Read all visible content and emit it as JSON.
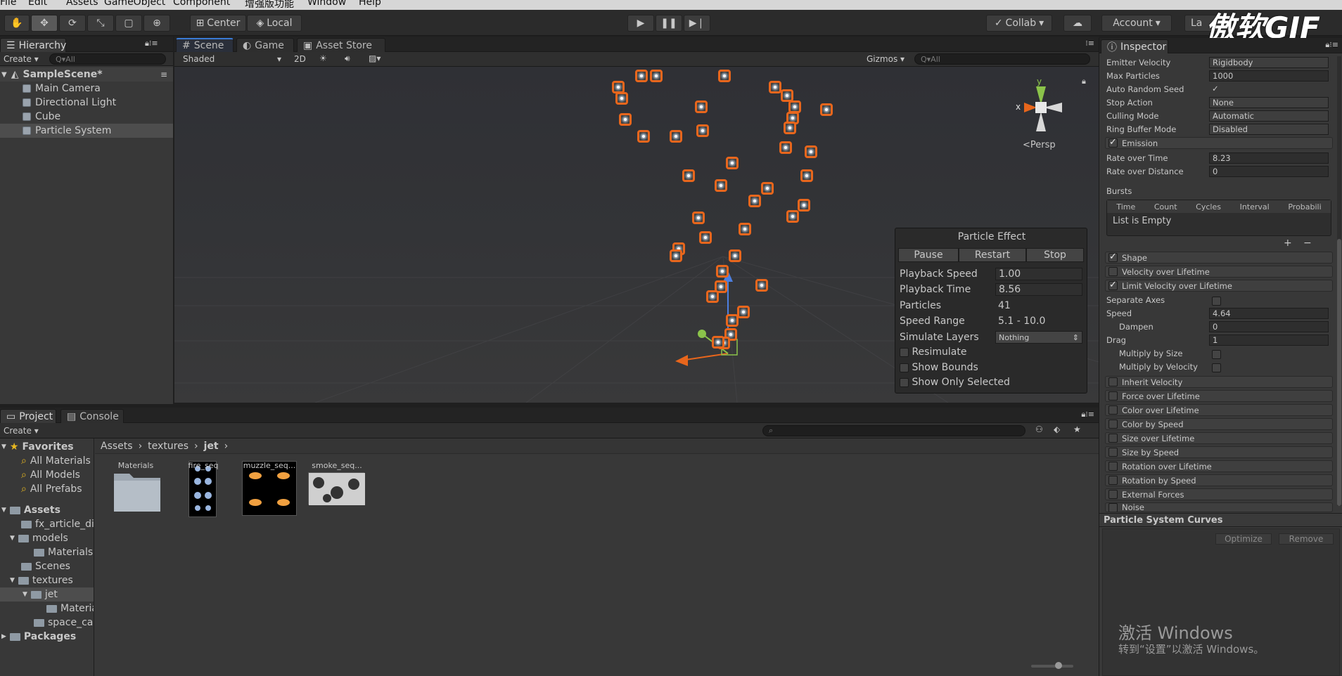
{
  "menu": [
    "File",
    "Edit",
    "Assets",
    "GameObject",
    "Component",
    "增强版功能",
    "Window",
    "Help"
  ],
  "toolbar": {
    "center_label": "Center",
    "local_label": "Local",
    "collab_label": "Collab",
    "account_label": "Account",
    "layers_label": "La"
  },
  "watermark": "傲软GIF",
  "hierarchy": {
    "tab": "Hierarchy",
    "create": "Create",
    "search_placeholder": "Q▾All",
    "scene_name": "SampleScene*",
    "items": [
      "Main Camera",
      "Directional Light",
      "Cube",
      "Particle System"
    ]
  },
  "scene_tabs": [
    "Scene",
    "Game",
    "Asset Store"
  ],
  "scene_bar": {
    "shading": "Shaded",
    "mode2d": "2D",
    "gizmos": "Gizmos",
    "search_placeholder": "Q▾All",
    "persp": "Persp",
    "axis_x": "x",
    "axis_y": "y"
  },
  "particle_effect": {
    "title": "Particle Effect",
    "buttons": [
      "Pause",
      "Restart",
      "Stop"
    ],
    "playback_speed_label": "Playback Speed",
    "playback_speed": "1.00",
    "playback_time_label": "Playback Time",
    "playback_time": "8.56",
    "particles_label": "Particles",
    "particles": "41",
    "speed_range_label": "Speed Range",
    "speed_range": "5.1 - 10.0",
    "simulate_layers_label": "Simulate Layers",
    "simulate_layers": "Nothing",
    "resimulate": "Resimulate",
    "show_bounds": "Show Bounds",
    "show_only_selected": "Show Only Selected"
  },
  "project": {
    "tabs": [
      "Project",
      "Console"
    ],
    "create": "Create",
    "favorites_label": "Favorites",
    "favorites": [
      "All Materials",
      "All Models",
      "All Prefabs"
    ],
    "assets_label": "Assets",
    "tree": [
      "fx_article_di",
      "models",
      "Materials",
      "Scenes",
      "textures",
      "jet",
      "Materia",
      "space_ca"
    ],
    "packages_label": "Packages",
    "breadcrumb": [
      "Assets",
      "textures",
      "jet"
    ],
    "assets": [
      "Materials",
      "fire_seq",
      "muzzle_seq...",
      "smoke_seq..."
    ]
  },
  "inspector": {
    "tab": "Inspector",
    "rows": [
      {
        "label": "Emitter Velocity",
        "value": "Rigidbody"
      },
      {
        "label": "Max Particles",
        "value": "1000"
      },
      {
        "label": "Auto Random Seed",
        "value": "✓"
      },
      {
        "label": "Stop Action",
        "value": "None"
      },
      {
        "label": "Culling Mode",
        "value": "Automatic"
      },
      {
        "label": "Ring Buffer Mode",
        "value": "Disabled"
      }
    ],
    "emission_label": "Emission",
    "rate_time_label": "Rate over Time",
    "rate_time": "8.23",
    "rate_distance_label": "Rate over Distance",
    "rate_distance": "0",
    "bursts_label": "Bursts",
    "burst_cols": [
      "Time",
      "Count",
      "Cycles",
      "Interval",
      "Probabili"
    ],
    "list_empty": "List is Empty",
    "shape_label": "Shape",
    "vol_label": "Velocity over Lifetime",
    "lvol_label": "Limit Velocity over Lifetime",
    "separate_axes": "Separate Axes",
    "speed_label": "Speed",
    "speed": "4.64",
    "dampen_label": "Dampen",
    "dampen": "0",
    "drag_label": "Drag",
    "drag": "1",
    "mult_size": "Multiply by Size",
    "mult_vel": "Multiply by Velocity",
    "modules": [
      "Inherit Velocity",
      "Force over Lifetime",
      "Color over Lifetime",
      "Color by Speed",
      "Size over Lifetime",
      "Size by Speed",
      "Rotation over Lifetime",
      "Rotation by Speed",
      "External Forces",
      "Noise"
    ],
    "curves_title": "Particle System Curves",
    "optimize": "Optimize",
    "remove": "Remove",
    "activate_title": "激活 Windows",
    "activate_sub": "转到“设置”以激活 Windows。"
  }
}
